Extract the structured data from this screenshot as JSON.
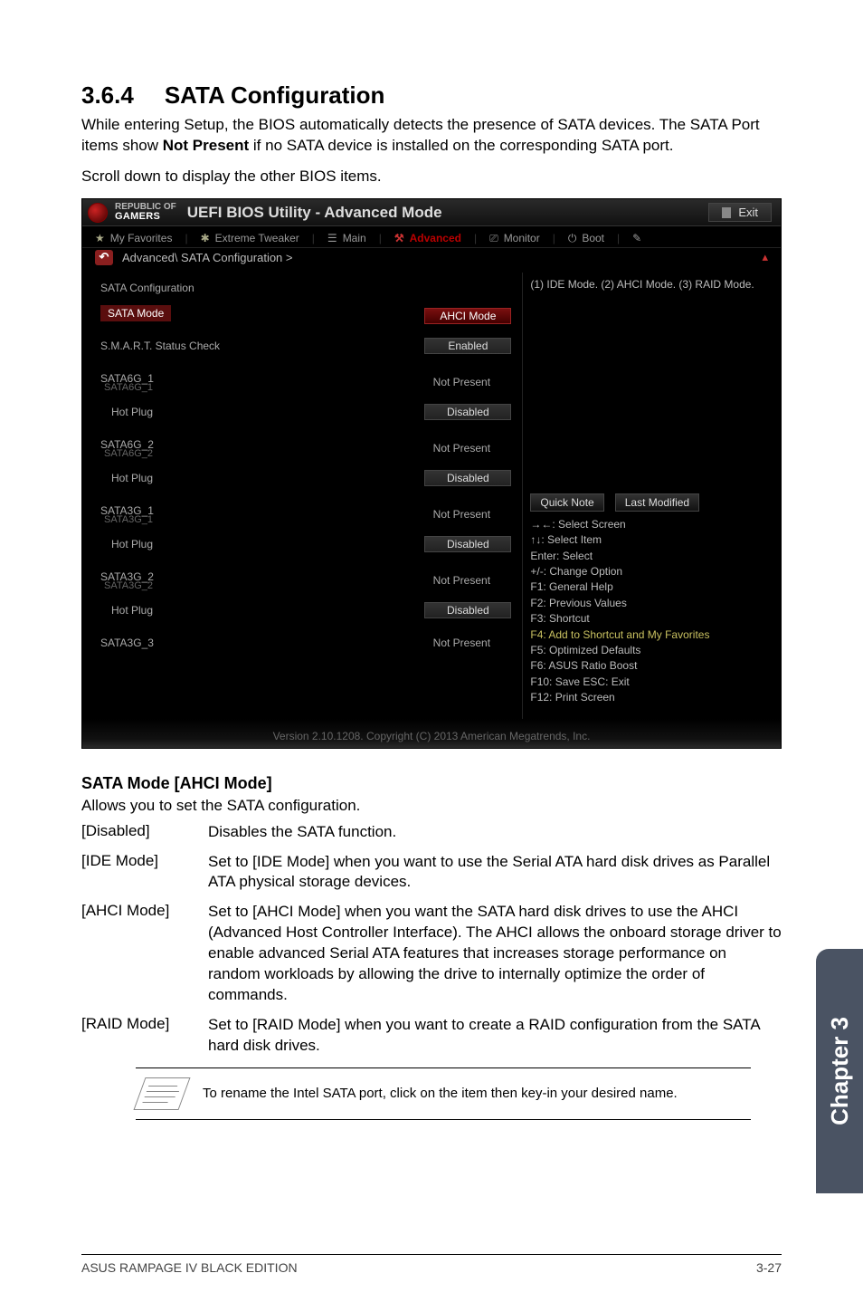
{
  "heading": {
    "number": "3.6.4",
    "title": "SATA Configuration"
  },
  "intro_pre": "While entering Setup, the BIOS automatically detects the presence of SATA devices. The SATA Port items show ",
  "intro_bold": "Not Present",
  "intro_post": " if no SATA device is installed on the corresponding SATA port.",
  "scroll_text": "Scroll down to display the other BIOS items.",
  "bios": {
    "brand_small": "REPUBLIC OF",
    "brand_big": "GAMERS",
    "utility_title": "UEFI BIOS Utility - Advanced Mode",
    "exit": "Exit",
    "tabs": {
      "fav": "My Favorites",
      "tweaker": "Extreme Tweaker",
      "main": "Main",
      "advanced": "Advanced",
      "monitor": "Monitor",
      "boot": "Boot",
      "tool": ""
    },
    "breadcrumb": "Advanced\\ SATA Configuration >",
    "left": {
      "sata_conf_label": "SATA Configuration",
      "sata_mode_label": "SATA Mode",
      "sata_mode_value": "AHCI Mode",
      "smart_label": "S.M.A.R.T. Status Check",
      "smart_value": "Enabled",
      "ports": [
        {
          "h": "SATA6G_1",
          "sub": "SATA6G_1",
          "val": "Not Present",
          "plug_label": "Hot Plug",
          "plug_val": "Disabled",
          "boxed": true
        },
        {
          "h": "SATA6G_2",
          "sub": "SATA6G_2",
          "val": "Not Present",
          "plug_label": "Hot Plug",
          "plug_val": "Disabled",
          "boxed": true
        },
        {
          "h": "SATA3G_1",
          "sub": "SATA3G_1",
          "val": "Not Present",
          "plug_label": "Hot Plug",
          "plug_val": "Disabled",
          "boxed": true
        },
        {
          "h": "SATA3G_2",
          "sub": "SATA3G_2",
          "val": "Not Present",
          "plug_label": "Hot Plug",
          "plug_val": "Disabled",
          "boxed": true
        },
        {
          "h": "SATA3G_3",
          "sub": "",
          "val": "Not Present",
          "plug_label": "",
          "plug_val": "",
          "boxed": false
        }
      ]
    },
    "right": {
      "help": "(1) IDE Mode. (2) AHCI Mode. (3) RAID Mode.",
      "quick_note": "Quick Note",
      "last_mod": "Last Modified",
      "shortcuts": [
        "→←: Select Screen",
        "↑↓: Select Item",
        "Enter: Select",
        "+/-: Change Option",
        "F1: General Help",
        "F2: Previous Values",
        "F3: Shortcut",
        "F4: Add to Shortcut and My Favorites",
        "F5: Optimized Defaults",
        "F6: ASUS Ratio Boost",
        "F10: Save  ESC: Exit",
        "F12: Print Screen"
      ]
    },
    "footer": "Version 2.10.1208. Copyright (C) 2013 American Megatrends, Inc."
  },
  "mode_section": {
    "heading": "SATA Mode [AHCI Mode]",
    "desc": "Allows you to set the SATA configuration.",
    "options": [
      {
        "label": "[Disabled]",
        "desc": "Disables the SATA function."
      },
      {
        "label": "[IDE Mode]",
        "desc": "Set to [IDE Mode] when you want to use the Serial ATA hard disk drives as Parallel ATA physical storage devices."
      },
      {
        "label": "[AHCI Mode]",
        "desc": "Set to [AHCI Mode] when you want the SATA hard disk drives to use the AHCI (Advanced Host Controller Interface). The AHCI allows the onboard storage driver to enable advanced Serial ATA features that increases storage performance on random workloads by allowing the drive to internally optimize the order of commands."
      },
      {
        "label": "[RAID Mode]",
        "desc": "Set to [RAID Mode] when you want to create a RAID configuration from the SATA hard disk drives."
      }
    ]
  },
  "note": "To rename the Intel SATA port, click on the item then key-in your desired name.",
  "side_tab": "Chapter 3",
  "footer_left": "ASUS RAMPAGE IV BLACK EDITION",
  "footer_right": "3-27"
}
